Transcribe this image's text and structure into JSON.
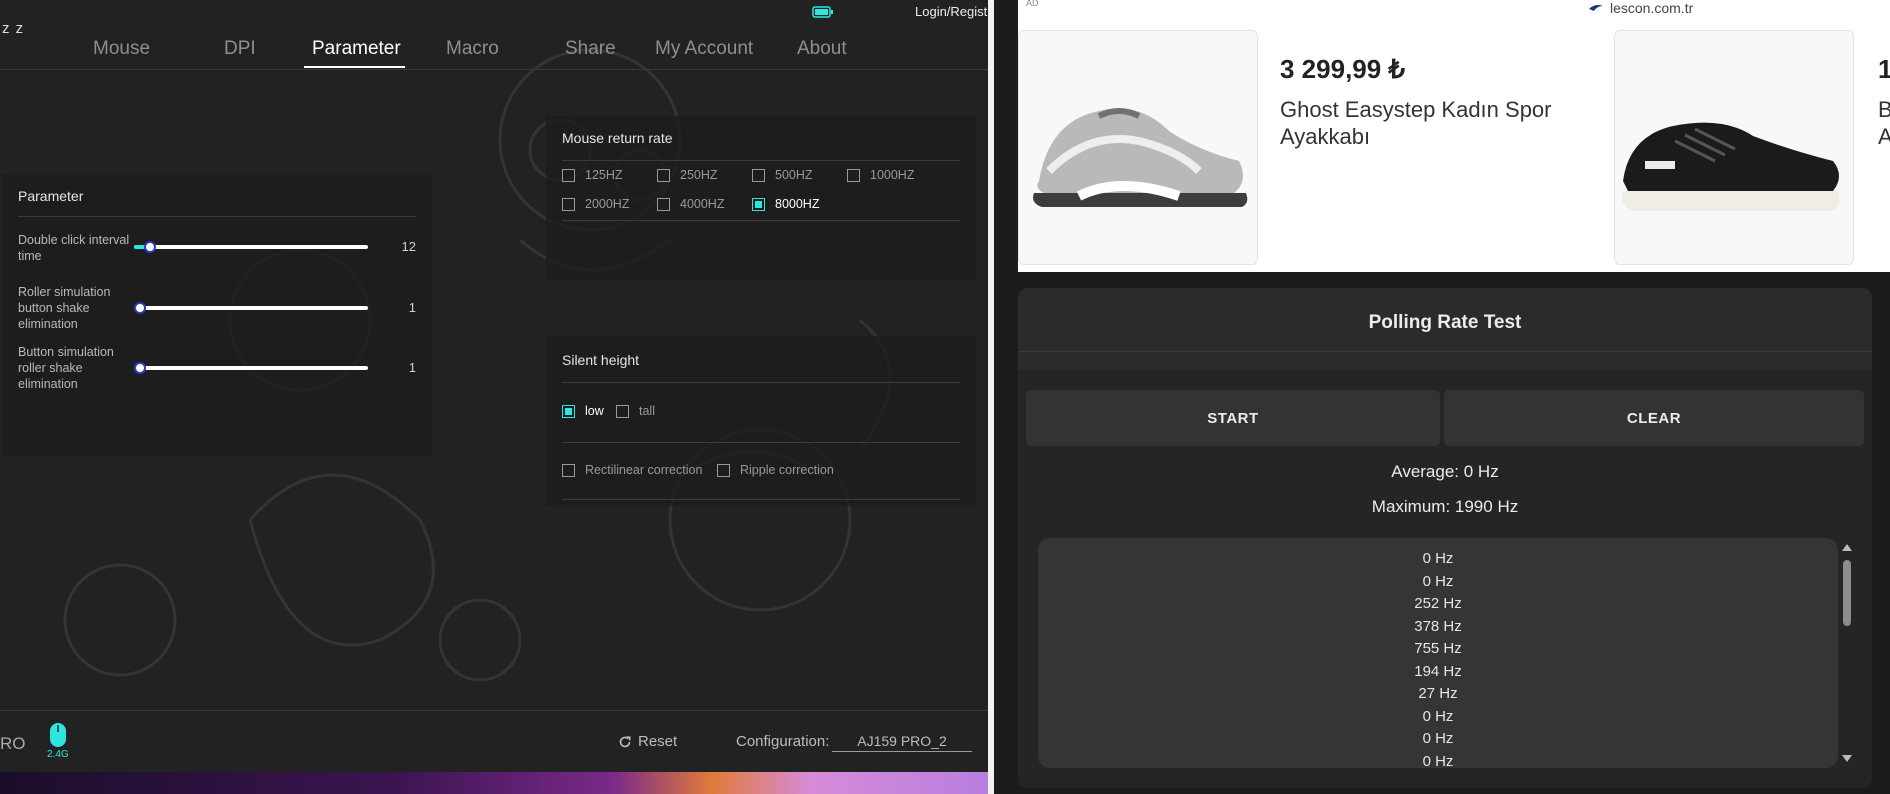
{
  "left_app": {
    "logo": "z z",
    "login_link": "Login/Regist",
    "nav": {
      "items": [
        {
          "label": "Mouse",
          "active": false
        },
        {
          "label": "DPI",
          "active": false
        },
        {
          "label": "Parameter",
          "active": true
        },
        {
          "label": "Macro",
          "active": false
        },
        {
          "label": "Share",
          "active": false
        },
        {
          "label": "My Account",
          "active": false
        },
        {
          "label": "About",
          "active": false
        }
      ]
    },
    "parameter_panel": {
      "title": "Parameter",
      "sliders": [
        {
          "label": "Double click interval time",
          "value": "12",
          "level": 0.07
        },
        {
          "label": "Roller simulation button shake elimination",
          "value": "1",
          "level": 0.0
        },
        {
          "label": "Button simulation roller shake elimination",
          "value": "1",
          "level": 0.0
        }
      ]
    },
    "return_rate_panel": {
      "title": "Mouse return rate",
      "options": [
        {
          "label": "125HZ",
          "checked": false
        },
        {
          "label": "250HZ",
          "checked": false
        },
        {
          "label": "500HZ",
          "checked": false
        },
        {
          "label": "1000HZ",
          "checked": false
        },
        {
          "label": "2000HZ",
          "checked": false
        },
        {
          "label": "4000HZ",
          "checked": false
        },
        {
          "label": "8000HZ",
          "checked": true
        }
      ]
    },
    "silent_panel": {
      "title": "Silent height",
      "height_options": [
        {
          "label": "low",
          "checked": true
        },
        {
          "label": "tall",
          "checked": false
        }
      ],
      "correction_options": [
        {
          "label": "Rectilinear correction",
          "checked": false
        },
        {
          "label": "Ripple correction",
          "checked": false
        }
      ]
    },
    "bottom_bar": {
      "model_suffix": "RO",
      "wireless_label": "2.4G",
      "reset_label": "Reset",
      "config_label": "Configuration:",
      "config_value": "AJ159 PRO_2"
    },
    "colors": {
      "accent": "#2ee6e0",
      "background": "#222222"
    }
  },
  "right_web": {
    "ad": {
      "badge": "AD",
      "domain": "lescon.com.tr",
      "products": [
        {
          "price": "3 299,99 ₺",
          "name": "Ghost Easystep Kadın Spor Ayakkabı"
        },
        {
          "price": "1",
          "name": "B A"
        }
      ]
    },
    "polling_test": {
      "title": "Polling Rate Test",
      "start_label": "START",
      "clear_label": "CLEAR",
      "average": "Average: 0 Hz",
      "maximum": "Maximum: 1990 Hz",
      "log": [
        "0 Hz",
        "0 Hz",
        "252 Hz",
        "378 Hz",
        "755 Hz",
        "194 Hz",
        "27 Hz",
        "0 Hz",
        "0 Hz",
        "0 Hz"
      ]
    }
  }
}
